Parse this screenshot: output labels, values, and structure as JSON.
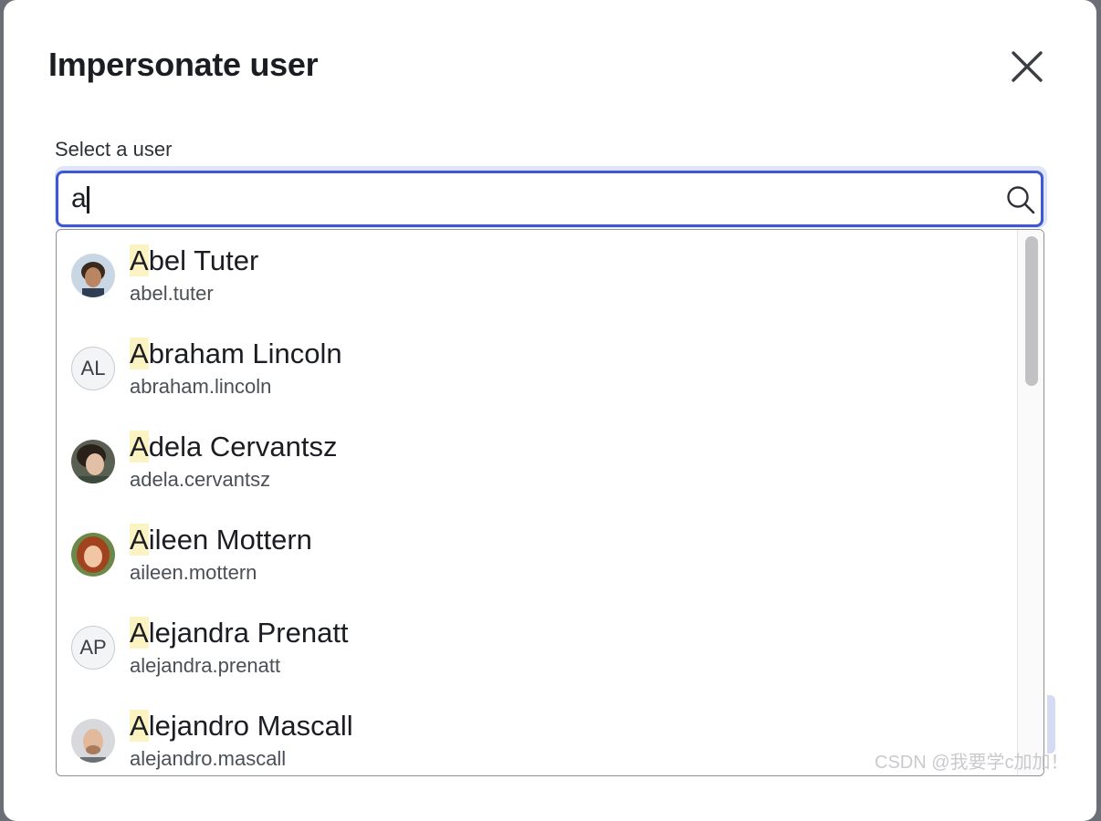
{
  "modal": {
    "title": "Impersonate user"
  },
  "field": {
    "label": "Select a user",
    "value": "a"
  },
  "results": [
    {
      "match": "A",
      "rest": "bel Tuter",
      "username": "abel.tuter",
      "avatar": "photo",
      "initials": ""
    },
    {
      "match": "A",
      "rest": "braham Lincoln",
      "username": "abraham.lincoln",
      "avatar": "initials",
      "initials": "AL"
    },
    {
      "match": "A",
      "rest": "dela Cervantsz",
      "username": "adela.cervantsz",
      "avatar": "photo",
      "initials": ""
    },
    {
      "match": "A",
      "rest": "ileen Mottern",
      "username": "aileen.mottern",
      "avatar": "photo",
      "initials": ""
    },
    {
      "match": "A",
      "rest": "lejandra Prenatt",
      "username": "alejandra.prenatt",
      "avatar": "initials",
      "initials": "AP"
    },
    {
      "match": "A",
      "rest": "lejandro Mascall",
      "username": "alejandro.mascall",
      "avatar": "photo",
      "initials": ""
    }
  ],
  "watermark": "CSDN @我要学c加加！",
  "colors": {
    "focus_border": "#3e57d6",
    "match_highlight": "#fbf4c2"
  }
}
